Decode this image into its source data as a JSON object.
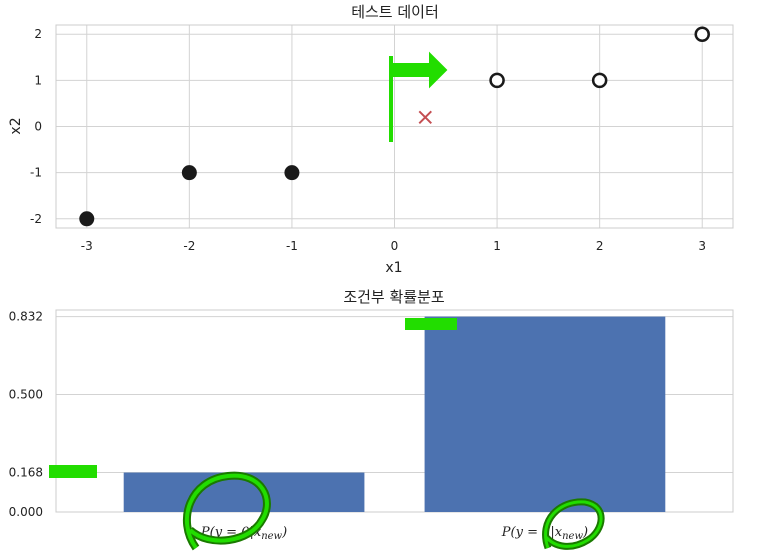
{
  "chart_data": [
    {
      "type": "scatter",
      "title": "테스트 데이터",
      "xlabel": "x1",
      "ylabel": "x2",
      "xlim": [
        -3.3,
        3.3
      ],
      "ylim": [
        -2.2,
        2.2
      ],
      "xticks": [
        -3,
        -2,
        -1,
        0,
        1,
        2,
        3
      ],
      "yticks": [
        -2,
        -1,
        0,
        1,
        2
      ],
      "grid": true,
      "series": [
        {
          "marker": "filled-circle",
          "color": "#1a1a1a",
          "points": [
            [
              -3,
              -2
            ],
            [
              -2,
              -1
            ],
            [
              -1,
              -1
            ]
          ]
        },
        {
          "marker": "open-circle",
          "color": "#1a1a1a",
          "points": [
            [
              1,
              1
            ],
            [
              2,
              1
            ],
            [
              3,
              2
            ]
          ]
        },
        {
          "marker": "x",
          "color": "#c44e52",
          "points": [
            [
              0.3,
              0.2
            ]
          ]
        }
      ]
    },
    {
      "type": "bar",
      "title": "조건부 확률분포",
      "categories": [
        "P(y = 0|x_new)",
        "P(y = 1|x_new)"
      ],
      "category_display": [
        {
          "pre": "P(y = 0|x",
          "sub": "new",
          "post": ")"
        },
        {
          "pre": "P(y = 1|x",
          "sub": "new",
          "post": ")"
        }
      ],
      "values": [
        0.168,
        0.832
      ],
      "ylim": [
        0,
        0.86
      ],
      "yticks": [
        0.0,
        0.168,
        0.5,
        0.832
      ],
      "ytick_labels": [
        "0.000",
        "0.168",
        "0.500",
        "0.832"
      ],
      "bar_color": "#4c72b0",
      "grid": true
    }
  ],
  "colors": {
    "grid": "#d3d3d3",
    "frame": "#cccccc",
    "annotation": "#22dd00",
    "annotation_dark": "#1a7a00"
  }
}
